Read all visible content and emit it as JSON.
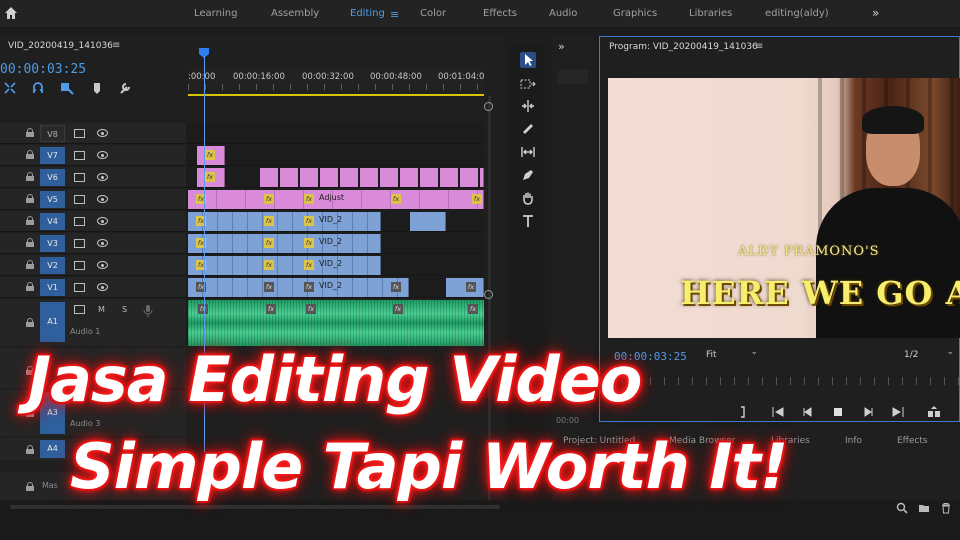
{
  "topbar": {
    "tabs": [
      {
        "label": "Learning",
        "active": false
      },
      {
        "label": "Assembly",
        "active": false
      },
      {
        "label": "Editing",
        "active": true
      },
      {
        "label": "Color",
        "active": false
      },
      {
        "label": "Effects",
        "active": false
      },
      {
        "label": "Audio",
        "active": false
      },
      {
        "label": "Graphics",
        "active": false
      },
      {
        "label": "Libraries",
        "active": false
      },
      {
        "label": "editing(aldy)",
        "active": false
      }
    ],
    "menu_glyph": "≡",
    "more_glyph": "»"
  },
  "timeline": {
    "sequence_name": "VID_20200419_141036",
    "menu_glyph": "≡",
    "timecode": "00:00:03:25",
    "ruler_labels": [
      ":00:00",
      "00:00:16:00",
      "00:00:32:00",
      "00:00:48:00",
      "00:01:04:0"
    ],
    "video_tracks": [
      "V8",
      "V7",
      "V6",
      "V5",
      "V4",
      "V3",
      "V2",
      "V1"
    ],
    "clip_labels": {
      "adjust": "Adjust",
      "vid": "VID_2"
    },
    "fx_badge": "fx",
    "audio_tracks": [
      {
        "id": "A1",
        "name": "Audio 1"
      },
      {
        "id": "A3",
        "name": "Audio 3"
      },
      {
        "id": "A4",
        "name": ""
      }
    ],
    "audio_buttons": {
      "mute": "M",
      "solo": "S"
    },
    "master_label": "Mas"
  },
  "overlay": {
    "line1": "Jasa Editing Video",
    "line2": "Simple Tapi Worth It!"
  },
  "program": {
    "title": "Program: VID_20200419_141036",
    "menu_glyph": "≡",
    "video_text_small": "ALDY PRAMONO'S",
    "video_text_big": "HERE WE GO AGA",
    "timecode": "00:00:03:25",
    "fit": "Fit",
    "resolution": "1/2",
    "side_timecode": "00:00"
  },
  "bottom_tabs": [
    "Project: Untitled",
    "Media Browser",
    "Libraries",
    "Info",
    "Effects"
  ],
  "colors": {
    "accent": "#4f9ce8",
    "pink_clip": "#d98ad9",
    "blue_clip": "#7fa2d6",
    "audio_clip": "#2fbf7f",
    "overlay_glow": "#ff2a2a"
  }
}
